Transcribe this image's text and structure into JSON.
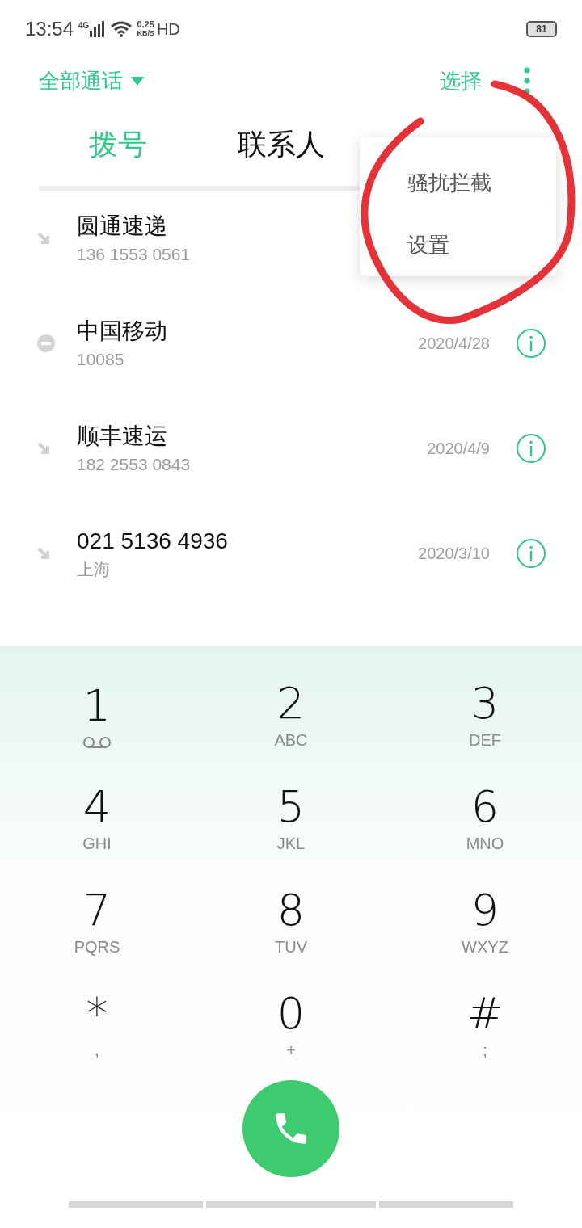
{
  "status_bar": {
    "time": "13:54",
    "network": "4G",
    "speed_value": "0.25",
    "speed_unit": "KB/S",
    "hd": "HD",
    "battery": "81"
  },
  "header": {
    "filter": "全部通话",
    "select": "选择"
  },
  "tabs": [
    {
      "label": "拨号",
      "selected": true
    },
    {
      "label": "联系人",
      "selected": false
    }
  ],
  "calls": [
    {
      "kind": "incoming",
      "name": "圆通速递",
      "detail": "136 1553 0561"
    },
    {
      "kind": "blocked",
      "name": "中国移动",
      "detail": "10085",
      "date": "2020/4/28"
    },
    {
      "kind": "incoming",
      "name": "顺丰速运",
      "detail": "182 2553 0843",
      "date": "2020/4/9"
    },
    {
      "kind": "incoming",
      "name": "021 5136 4936",
      "detail": "上海",
      "date": "2020/3/10"
    }
  ],
  "menu": {
    "items": [
      "骚扰拦截",
      "设置"
    ]
  },
  "keypad": [
    {
      "digit": "1",
      "kind": "voicemail"
    },
    {
      "digit": "2",
      "kind": "letters",
      "letters": "ABC"
    },
    {
      "digit": "3",
      "kind": "letters",
      "letters": "DEF"
    },
    {
      "digit": "4",
      "kind": "letters",
      "letters": "GHI"
    },
    {
      "digit": "5",
      "kind": "letters",
      "letters": "JKL"
    },
    {
      "digit": "6",
      "kind": "letters",
      "letters": "MNO"
    },
    {
      "digit": "7",
      "kind": "letters",
      "letters": "PQRS"
    },
    {
      "digit": "8",
      "kind": "letters",
      "letters": "TUV"
    },
    {
      "digit": "9",
      "kind": "letters",
      "letters": "WXYZ"
    },
    {
      "digit": "*",
      "kind": "letters",
      "letters": ","
    },
    {
      "digit": "0",
      "kind": "letters",
      "letters": "+"
    },
    {
      "digit": "#",
      "kind": "letters",
      "letters": ";"
    }
  ]
}
